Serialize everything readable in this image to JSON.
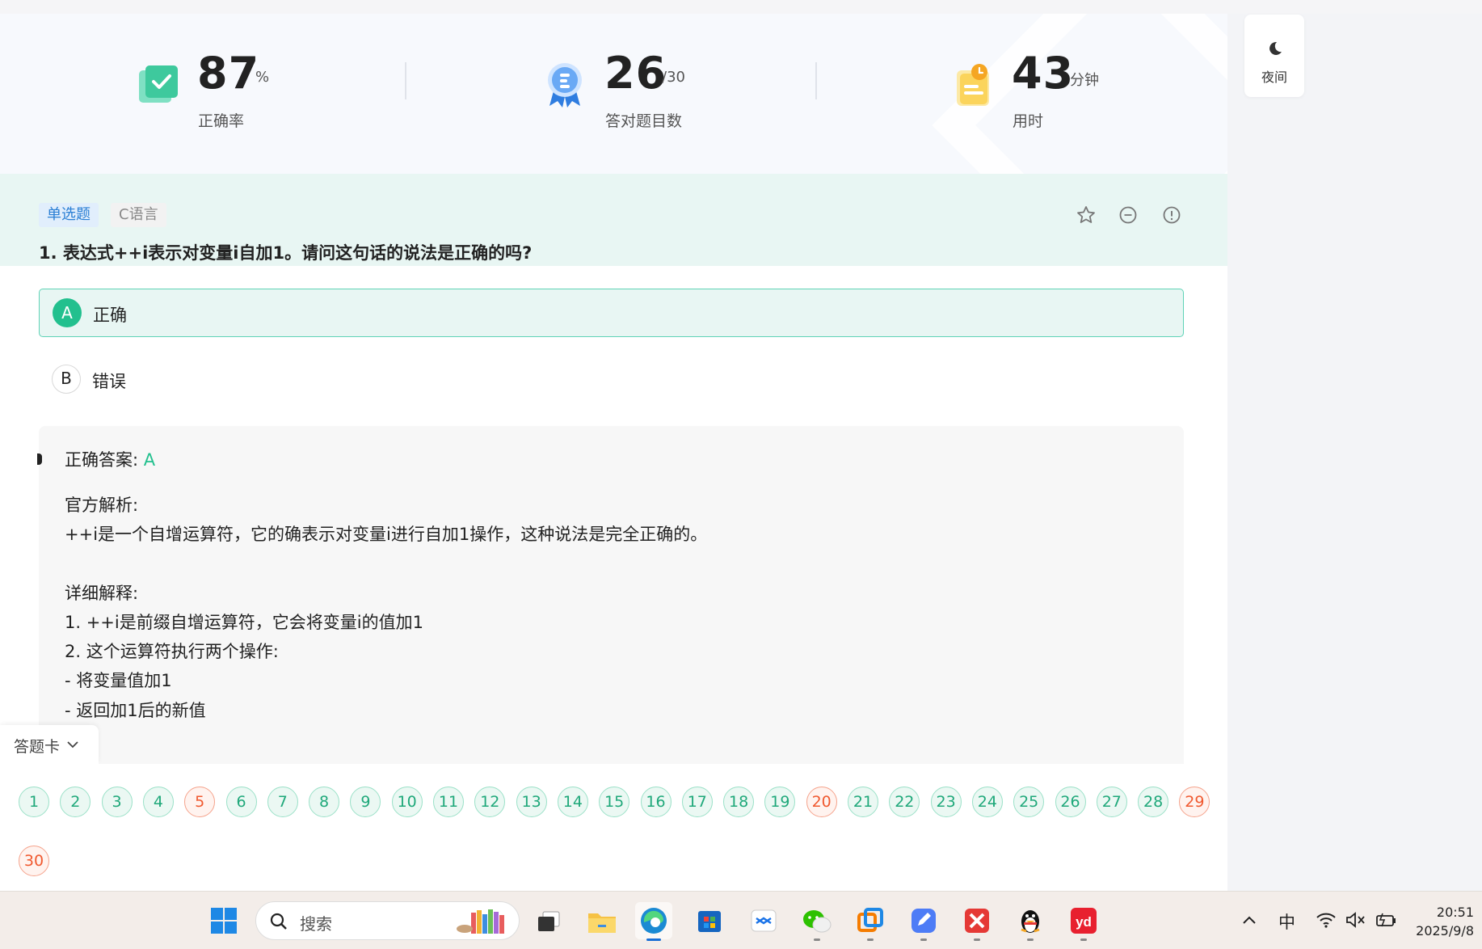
{
  "stats": [
    {
      "value": "87",
      "unit": "%",
      "label": "正确率",
      "icon": "correct-rate-icon"
    },
    {
      "value": "26",
      "unit": "/30",
      "label": "答对题目数",
      "icon": "award-medal-icon"
    },
    {
      "value": "43",
      "unit": "分钟",
      "label": "用时",
      "icon": "clock-note-icon"
    }
  ],
  "question": {
    "type_tag": "单选题",
    "lang_tag": "C语言",
    "text": "1. 表达式++i表示对变量i自加1。请问这句话的说法是正确的吗?",
    "options": [
      {
        "letter": "A",
        "text": "正确",
        "selected": true
      },
      {
        "letter": "B",
        "text": "错误",
        "selected": false
      }
    ]
  },
  "analysis": {
    "answer_label": "正确答案:",
    "answer_value": "A",
    "lines": [
      "官方解析:",
      "++i是一个自增运算符，它的确表示对变量i进行自加1操作，这种说法是完全正确的。",
      "",
      "详细解释:",
      "1. ++i是前缀自增运算符，它会将变量i的值加1",
      "2. 这个运算符执行两个操作:",
      "- 将变量值加1",
      "- 返回加1后的新值"
    ]
  },
  "answer_card": {
    "label": "答题卡",
    "numbers": [
      "1",
      "2",
      "3",
      "4",
      "5",
      "6",
      "7",
      "8",
      "9",
      "10",
      "11",
      "12",
      "13",
      "14",
      "15",
      "16",
      "17",
      "18",
      "19",
      "20",
      "21",
      "22",
      "23",
      "24",
      "25",
      "26",
      "27",
      "28",
      "29",
      "30"
    ],
    "wrong": [
      "5",
      "20",
      "29",
      "30"
    ]
  },
  "night_mode": {
    "label": "夜间"
  },
  "taskbar": {
    "search_placeholder": "搜索",
    "ime": "中",
    "time": "20:51",
    "date": "2025/9/8"
  },
  "colors": {
    "accent": "#22c08e",
    "wrong": "#f0592f",
    "link": "#2a7fd4"
  }
}
